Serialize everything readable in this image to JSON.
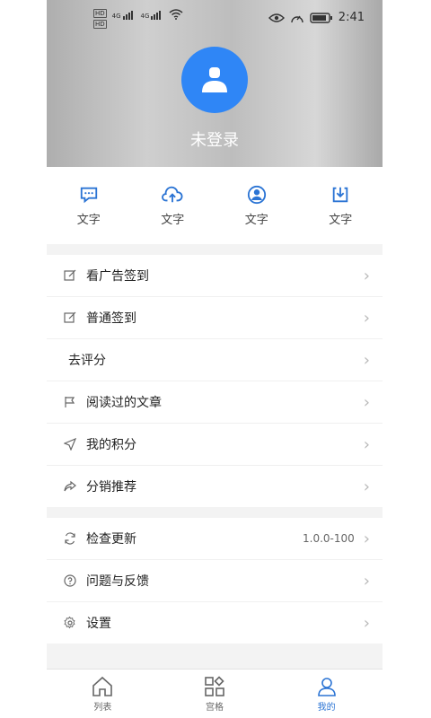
{
  "status": {
    "left_badges": [
      "HD",
      "HD"
    ],
    "left_signal_labels": [
      "4G",
      "4G"
    ],
    "time": "2:41"
  },
  "profile": {
    "login_text": "未登录"
  },
  "quick_actions": [
    {
      "label": "文字",
      "icon": "chat-icon"
    },
    {
      "label": "文字",
      "icon": "cloud-upload-icon"
    },
    {
      "label": "文字",
      "icon": "user-circle-icon"
    },
    {
      "label": "文字",
      "icon": "download-icon"
    }
  ],
  "menu_group1": [
    {
      "label": "看广告签到",
      "icon": "edit-icon"
    },
    {
      "label": "普通签到",
      "icon": "edit-icon"
    },
    {
      "label": "去评分",
      "icon": ""
    },
    {
      "label": "阅读过的文章",
      "icon": "flag-icon"
    },
    {
      "label": "我的积分",
      "icon": "send-icon"
    },
    {
      "label": "分销推荐",
      "icon": "share-icon"
    }
  ],
  "menu_group2": [
    {
      "label": "检查更新",
      "icon": "refresh-icon",
      "value": "1.0.0-100"
    },
    {
      "label": "问题与反馈",
      "icon": "help-icon"
    },
    {
      "label": "设置",
      "icon": "settings-icon"
    }
  ],
  "tabs": [
    {
      "label": "列表",
      "icon": "home-icon",
      "active": false
    },
    {
      "label": "宫格",
      "icon": "grid-icon",
      "active": false
    },
    {
      "label": "我的",
      "icon": "user-icon",
      "active": true
    }
  ],
  "colors": {
    "accent": "#2F86F6",
    "tab_active": "#2B74D4"
  }
}
